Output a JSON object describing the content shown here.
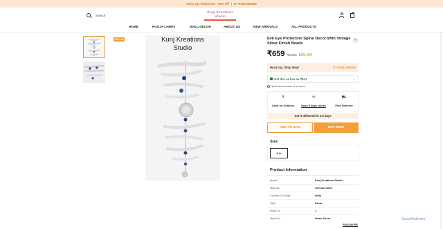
{
  "announcement": {
    "left": "Hurry Up, Shop Now! - 50% Off",
    "right": "+91913396383"
  },
  "header": {
    "search_placeholder": "Search",
    "logo_text": "Kunj Kreations Studio"
  },
  "nav": [
    "HOME",
    "POOJA LAMPS",
    "WALL DECOR",
    "ABOUT US",
    "NEW ARRIVALS",
    "ALL PRODUCTS"
  ],
  "gallery": {
    "discount_tag": "50% off",
    "image_brand_line1": "Kunj Kreations",
    "image_brand_line2": "Studio"
  },
  "product": {
    "title": "Evil Eye Protection Spiral Decor With Vintage Silver Finish Beads",
    "price": "₹659",
    "mrp": "₹1,399",
    "off": "52% Off",
    "hurry_text": "Hurry Up, Shop Now!",
    "hurry_phone": "+91913396383",
    "offer_text": "Get this as low as ₹641",
    "incl_text": "Final Price inclusive of all taxes",
    "features": [
      {
        "icon": "₹",
        "label": "Cash on Delivery"
      },
      {
        "icon": "⟲",
        "label": "Easy 5 days return"
      },
      {
        "icon": "⛟",
        "label": "Free Delivery"
      }
    ],
    "delivery": "Get it delivered in 4-9 days",
    "add_to_bag": "ADD TO BAG",
    "buy_now": "BUY NOW",
    "size_heading": "Size",
    "size_option": "8 in",
    "info_heading": "Product Information",
    "info_rows": [
      {
        "key": "Brand",
        "value": "Kunj Kreations Studio"
      },
      {
        "key": "Material",
        "value": "German Silver"
      },
      {
        "key": "Country Of Origin",
        "value": "India"
      },
      {
        "key": "Type",
        "value": "Decor"
      },
      {
        "key": "Piece Of",
        "value": "1"
      },
      {
        "key": "Ideal For",
        "value": "Home Decor"
      }
    ],
    "read_more": "READ MORE"
  },
  "watermark": "ScanMalware"
}
